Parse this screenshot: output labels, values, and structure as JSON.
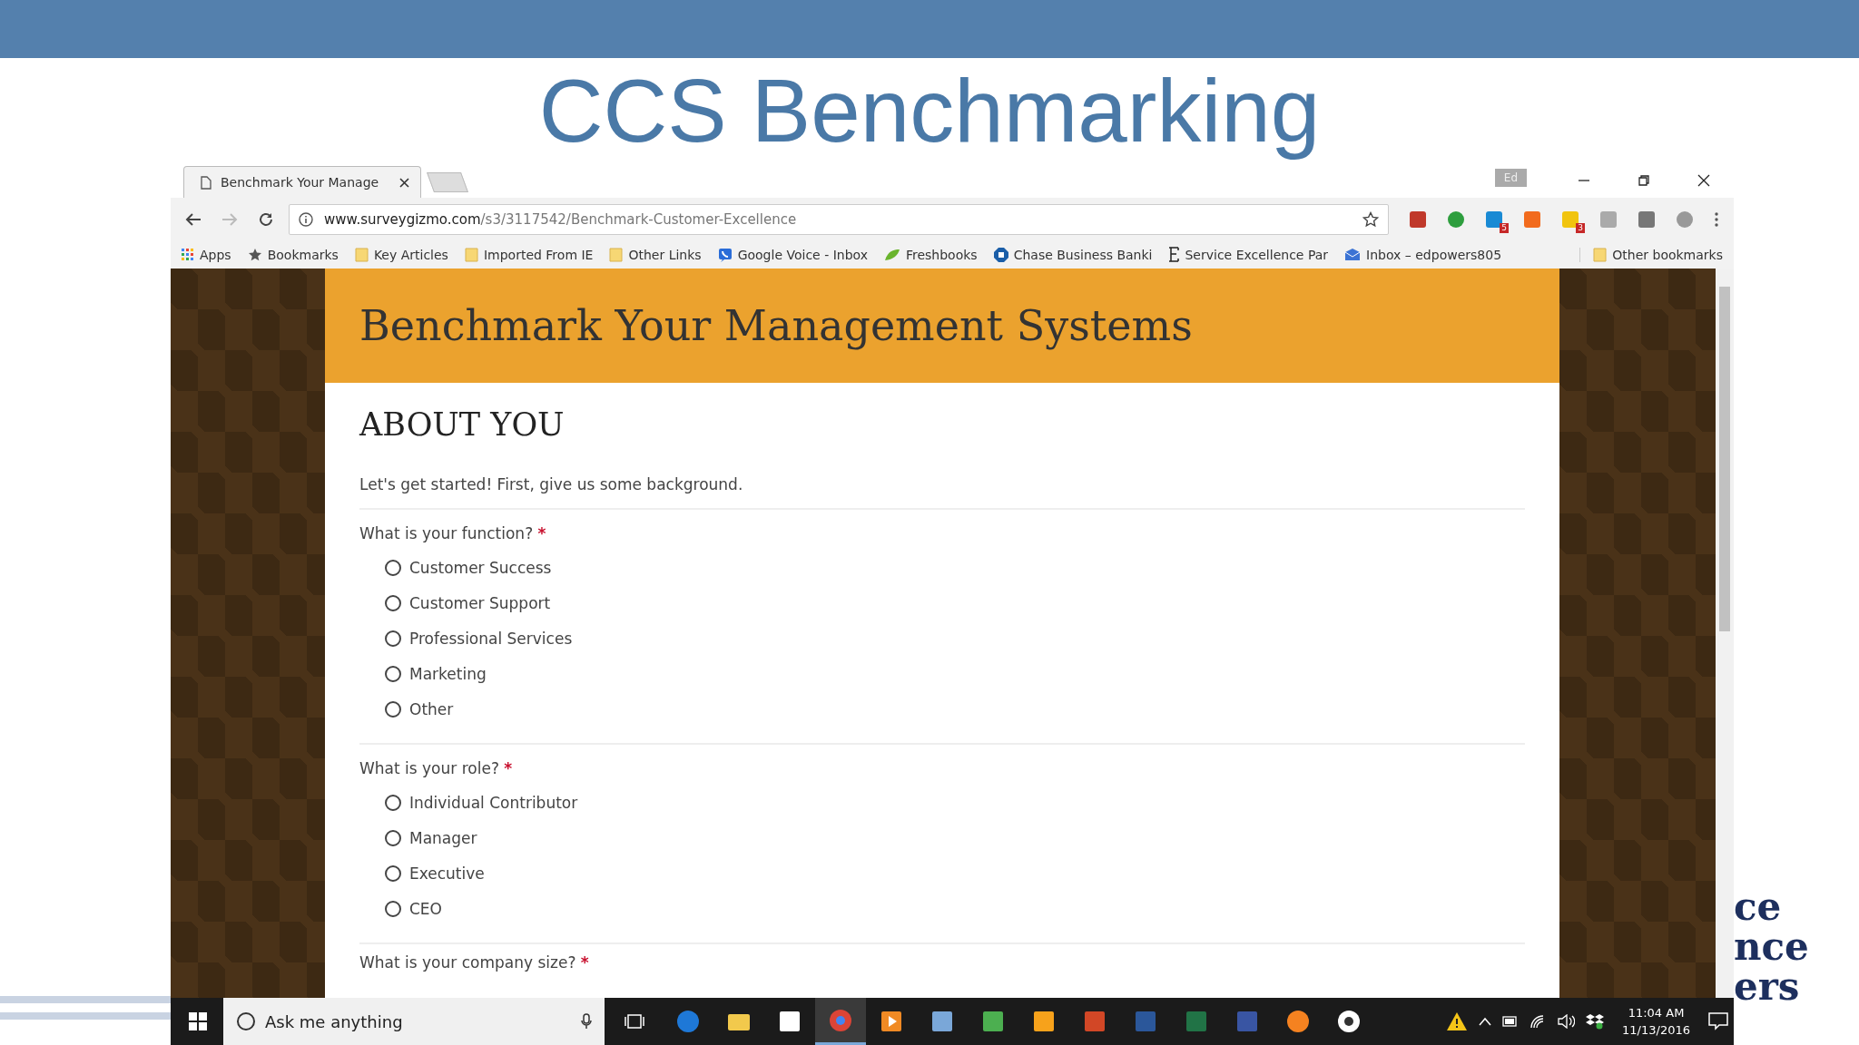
{
  "slide": {
    "title": "CCS Benchmarking",
    "side_text": [
      "ce",
      "nce",
      "ers"
    ]
  },
  "browser": {
    "tab": {
      "title": "Benchmark Your Manage"
    },
    "profile": "Ed",
    "url": {
      "host": "www.surveygizmo.com",
      "path": "/s3/3117542/Benchmark-Customer-Excellence"
    },
    "extensions": [
      {
        "kind": "elephant"
      },
      {
        "kind": "pin"
      },
      {
        "kind": "check",
        "badge": "5"
      },
      {
        "kind": "chart"
      },
      {
        "kind": "notes",
        "badge": "3"
      },
      {
        "kind": "letter"
      },
      {
        "kind": "square"
      },
      {
        "kind": "circle"
      }
    ],
    "bookmarks": [
      {
        "label": "Apps",
        "kind": "apps"
      },
      {
        "label": "Bookmarks",
        "kind": "star"
      },
      {
        "label": "Key Articles",
        "kind": "folder"
      },
      {
        "label": "Imported From IE",
        "kind": "folder"
      },
      {
        "label": "Other Links",
        "kind": "folder"
      },
      {
        "label": "Google Voice - Inbox",
        "kind": "phone"
      },
      {
        "label": "Freshbooks",
        "kind": "leaf"
      },
      {
        "label": "Chase Business Banki",
        "kind": "bank"
      },
      {
        "label": "Service Excellence Par",
        "kind": "letter"
      },
      {
        "label": "Inbox – edpowers805",
        "kind": "mail"
      }
    ],
    "other_bookmarks": "Other bookmarks"
  },
  "survey": {
    "title": "Benchmark Your Management Systems",
    "section": "ABOUT YOU",
    "intro": "Let's get started! First, give us some background.",
    "questions": [
      {
        "label": "What is your function?",
        "mark": "*",
        "options": [
          {
            "label": "Customer Success",
            "selected": false
          },
          {
            "label": "Customer Support",
            "selected": false
          },
          {
            "label": "Professional Services",
            "selected": false
          },
          {
            "label": "Marketing",
            "selected": false
          },
          {
            "label": "Other",
            "selected": false
          }
        ]
      },
      {
        "label": "What is your role?",
        "mark": "*",
        "options": [
          {
            "label": "Individual Contributor",
            "selected": false
          },
          {
            "label": "Manager",
            "selected": false
          },
          {
            "label": "Executive",
            "selected": false
          },
          {
            "label": "CEO",
            "selected": false
          }
        ]
      },
      {
        "label": "What is your company size?",
        "mark": "*"
      }
    ]
  },
  "taskbar": {
    "search_placeholder": "Ask me anything",
    "time": "11:04 AM",
    "date": "11/13/2016"
  }
}
